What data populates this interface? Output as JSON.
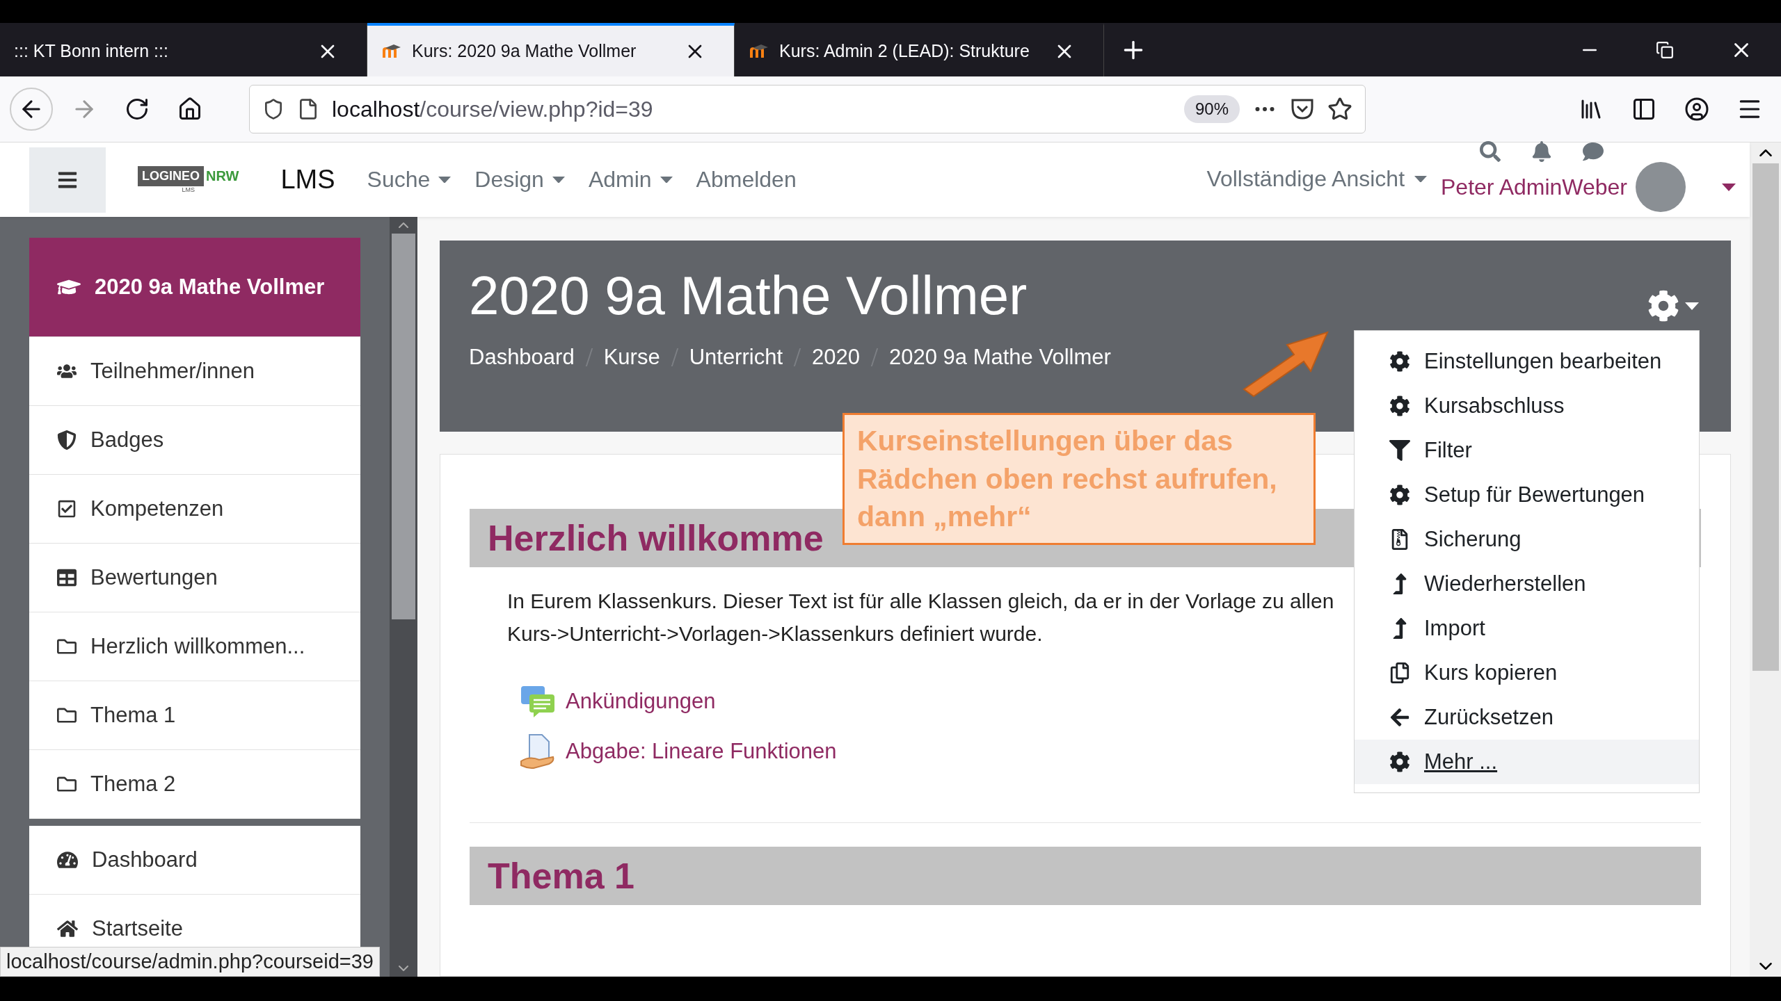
{
  "browser": {
    "tabs": [
      {
        "title": "::: KT Bonn intern :::",
        "selected": false,
        "favicon": false
      },
      {
        "title": "Kurs: 2020 9a Mathe Vollmer",
        "selected": true,
        "favicon": true
      },
      {
        "title": "Kurs: Admin 2 (LEAD): Strukture",
        "selected": false,
        "favicon": true
      }
    ],
    "url": {
      "host": "localhost",
      "path": "/course/view.php?id=39"
    },
    "zoom": "90%"
  },
  "logo": {
    "name": "LOGINEO",
    "region": "NRW",
    "subtitle": "LMS"
  },
  "navbar": {
    "site": "LMS",
    "menus": [
      {
        "label": "Suche",
        "dropdown": true
      },
      {
        "label": "Design",
        "dropdown": true
      },
      {
        "label": "Admin",
        "dropdown": true
      },
      {
        "label": "Abmelden",
        "dropdown": false
      }
    ],
    "view_switch": {
      "label": "Vollständige Ansicht",
      "dropdown": true
    },
    "user": "Peter AdminWeber"
  },
  "sidebar": {
    "items": [
      {
        "label": "2020 9a Mathe Vollmer",
        "selected": true
      },
      {
        "label": "Teilnehmer/innen",
        "selected": false
      },
      {
        "label": "Badges",
        "selected": false
      },
      {
        "label": "Kompetenzen",
        "selected": false
      },
      {
        "label": "Bewertungen",
        "selected": false
      },
      {
        "label": "Herzlich willkommen...",
        "selected": false
      },
      {
        "label": "Thema 1",
        "selected": false
      },
      {
        "label": "Thema 2",
        "selected": false
      }
    ],
    "items_2": [
      {
        "label": "Dashboard",
        "selected": false
      },
      {
        "label": "Startseite",
        "selected": false
      }
    ]
  },
  "course": {
    "title": "2020 9a Mathe Vollmer",
    "breadcrumb": [
      "Dashboard",
      "Kurse",
      "Unterricht",
      "2020",
      "2020 9a Mathe Vollmer"
    ]
  },
  "settings_menu": {
    "items": [
      {
        "label": "Einstellungen bearbeiten",
        "highlighted": false
      },
      {
        "label": "Kursabschluss",
        "highlighted": false
      },
      {
        "label": "Filter",
        "highlighted": false
      },
      {
        "label": "Setup für Bewertungen",
        "highlighted": false
      },
      {
        "label": "Sicherung",
        "highlighted": false
      },
      {
        "label": "Wiederherstellen",
        "highlighted": false
      },
      {
        "label": "Import",
        "highlighted": false
      },
      {
        "label": "Kurs kopieren",
        "highlighted": false
      },
      {
        "label": "Zurücksetzen",
        "highlighted": false
      },
      {
        "label": "Mehr ...",
        "highlighted": true
      }
    ]
  },
  "callout": {
    "text": "Kurseinstellungen über das Rädchen oben rechst aufrufen, dann „mehr“"
  },
  "sections": [
    {
      "title": "Herzlich willkomme",
      "summary": "In Eurem Klassenkurs. Dieser Text ist für alle Klassen gleich, da er in der Vorlage zu allen Kurs->Unterricht->Vorlagen->Klassenkurs definiert wurde.",
      "activities": [
        {
          "label": "Ankündigungen",
          "kind": "forum"
        },
        {
          "label": "Abgabe: Lineare Funktionen",
          "kind": "assign"
        }
      ]
    },
    {
      "title": "Thema 1"
    }
  ],
  "status_url": "localhost/course/admin.php?courseid=39"
}
